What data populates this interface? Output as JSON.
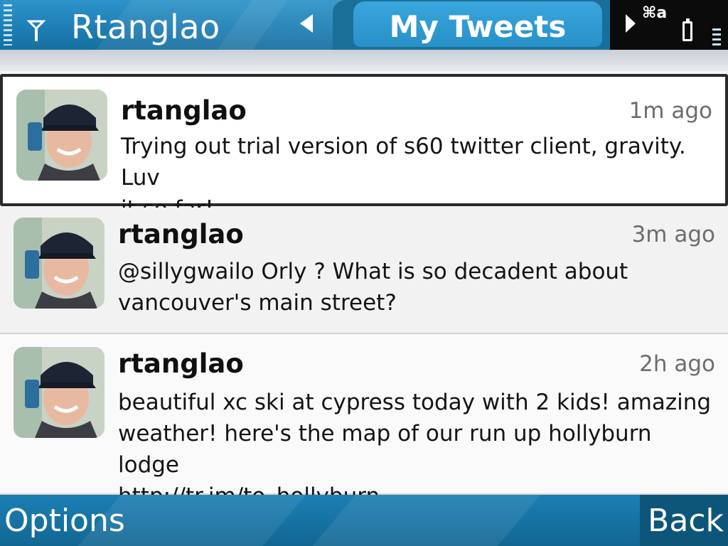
{
  "header": {
    "title": "Rtanglao",
    "active_tab": "My Tweets",
    "mode_indicator": "⌘a",
    "icons": [
      "signal-strength-icon",
      "antenna-icon",
      "chevron-left-icon",
      "chevron-right-icon",
      "battery-icon"
    ]
  },
  "tweets": [
    {
      "username": "rtanglao",
      "time": "1m ago",
      "text_lines": [
        "Trying out trial version of s60 twitter client, gravity. Luv",
        "it so far!"
      ],
      "selected": true
    },
    {
      "username": "rtanglao",
      "time": "3m ago",
      "text_lines": [
        "@sillygwailo Orly ? What is so decadent about",
        "vancouver's main street?"
      ],
      "selected": false
    },
    {
      "username": "rtanglao",
      "time": "2h ago",
      "text_lines": [
        "beautiful xc ski at cypress today with 2 kids! amazing",
        "weather! here's the map of our run up hollyburn lodge",
        "http://tr.im/to_hollyburn"
      ],
      "selected": false
    }
  ],
  "softkeys": {
    "left": "Options",
    "right": "Back"
  },
  "colors": {
    "bar_blue": "#1d7db3",
    "tab_active": "#3aa6dc",
    "status_black": "#0b0b0b"
  }
}
